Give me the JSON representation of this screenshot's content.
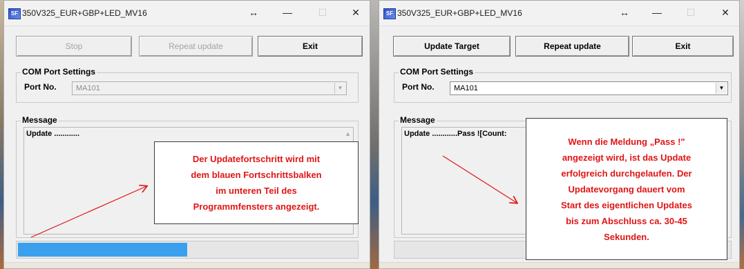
{
  "left_window": {
    "title": "350V325_EUR+GBP+LED_MV16",
    "buttons": {
      "stop": "Stop",
      "repeat": "Repeat update",
      "exit": "Exit"
    },
    "com": {
      "group_label": "COM Port Settings",
      "port_label": "Port No.",
      "port_value": "MA101"
    },
    "message": {
      "group_label": "Message",
      "text": "Update ............"
    },
    "progress": 0.5,
    "annotation": [
      "Der Updatefortschritt wird mit",
      "dem blauen Fortschrittsbalken",
      "im unteren Teil des",
      "Programmfensters angezeigt."
    ]
  },
  "right_window": {
    "title": "350V325_EUR+GBP+LED_MV16",
    "buttons": {
      "update": "Update Target",
      "repeat": "Repeat update",
      "exit": "Exit"
    },
    "com": {
      "group_label": "COM Port Settings",
      "port_label": "Port No.",
      "port_value": "MA101"
    },
    "message": {
      "group_label": "Message",
      "text": "Update ............Pass ![Count:"
    },
    "progress": 0,
    "annotation": [
      "Wenn die Meldung „Pass !\"",
      "angezeigt wird, ist das Update",
      "erfolgreich durchgelaufen. Der",
      "Updatevorgang dauert vom",
      "Start des eigentlichen Updates",
      "bis zum Abschluss ca. 30-45",
      "Sekunden."
    ]
  },
  "titlebar_icons": [
    "app-icon",
    "move-icon",
    "minimize-icon",
    "maximize-icon",
    "close-icon"
  ],
  "colors": {
    "annotation_text": "#e01515",
    "progress_fill": "#3aa0ee"
  }
}
